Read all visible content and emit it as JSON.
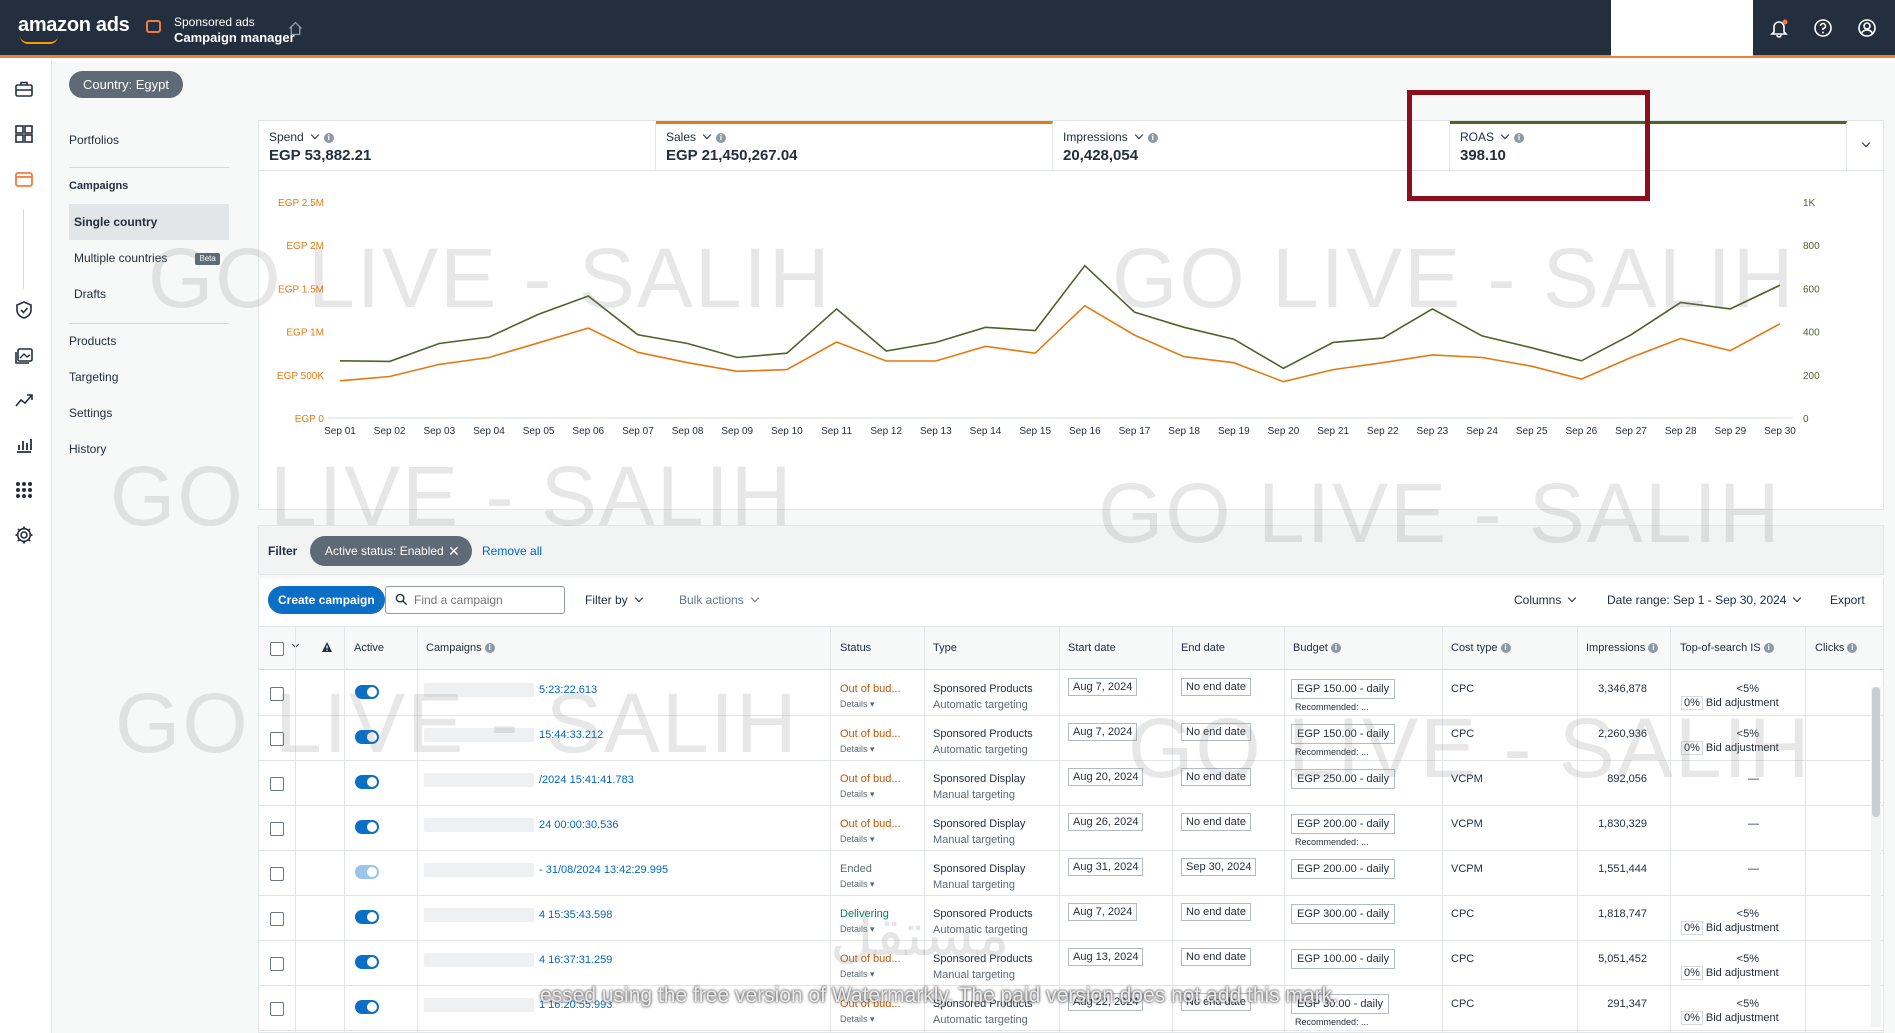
{
  "app": {
    "logo": "amazon ads",
    "name_line1": "Sponsored ads",
    "name_line2": "Campaign manager"
  },
  "sidebar": {
    "country_pill": "Country: Egypt",
    "portfolios": "Portfolios",
    "campaigns_heading": "Campaigns",
    "single_country": "Single country",
    "multiple_countries": "Multiple countries",
    "beta": "Beta",
    "drafts": "Drafts",
    "products": "Products",
    "targeting": "Targeting",
    "settings": "Settings",
    "history": "History"
  },
  "metrics": [
    {
      "label": "Spend",
      "value": "EGP 53,882.21",
      "accent": "#ffffff"
    },
    {
      "label": "Sales",
      "value": "EGP 21,450,267.04",
      "accent": "#e47911"
    },
    {
      "label": "Impressions",
      "value": "20,428,054",
      "accent": "#ffffff"
    },
    {
      "label": "ROAS",
      "value": "398.10",
      "accent": "#4f6228"
    }
  ],
  "chart_data": {
    "type": "line",
    "x": [
      "Sep 01",
      "Sep 02",
      "Sep 03",
      "Sep 04",
      "Sep 05",
      "Sep 06",
      "Sep 07",
      "Sep 08",
      "Sep 09",
      "Sep 10",
      "Sep 11",
      "Sep 12",
      "Sep 13",
      "Sep 14",
      "Sep 15",
      "Sep 16",
      "Sep 17",
      "Sep 18",
      "Sep 19",
      "Sep 20",
      "Sep 21",
      "Sep 22",
      "Sep 23",
      "Sep 24",
      "Sep 25",
      "Sep 26",
      "Sep 27",
      "Sep 28",
      "Sep 29",
      "Sep 30"
    ],
    "left_axis": {
      "ticks": [
        "EGP 0",
        "EGP 500K",
        "EGP 1M",
        "EGP 1.5M",
        "EGP 2M",
        "EGP 2.5M"
      ],
      "ylim": [
        0,
        2500000
      ]
    },
    "right_axis": {
      "ticks": [
        "0",
        "200",
        "400",
        "600",
        "800",
        "1K"
      ],
      "ylim": [
        0,
        1000
      ]
    },
    "series": [
      {
        "name": "Sales",
        "axis": "left",
        "color": "#e47911",
        "values": [
          430000,
          480000,
          620000,
          700000,
          870000,
          1040000,
          760000,
          640000,
          540000,
          560000,
          880000,
          660000,
          660000,
          830000,
          750000,
          1300000,
          960000,
          710000,
          640000,
          420000,
          560000,
          640000,
          730000,
          700000,
          600000,
          450000,
          700000,
          920000,
          780000,
          1090000
        ]
      },
      {
        "name": "ROAS",
        "axis": "right",
        "color": "#4f6228",
        "values": [
          265,
          262,
          345,
          375,
          480,
          565,
          385,
          345,
          280,
          300,
          505,
          310,
          350,
          420,
          405,
          705,
          490,
          420,
          365,
          230,
          350,
          370,
          505,
          380,
          325,
          265,
          385,
          535,
          505,
          615
        ]
      }
    ]
  },
  "filter": {
    "label": "Filter",
    "chip": "Active status: Enabled",
    "remove_all": "Remove all"
  },
  "toolbar": {
    "create": "Create campaign",
    "search_placeholder": "Find a campaign",
    "filter_by": "Filter by",
    "bulk_actions": "Bulk actions",
    "columns": "Columns",
    "date_range": "Date range: Sep 1 - Sep 30, 2024",
    "export": "Export"
  },
  "table": {
    "headers": {
      "active": "Active",
      "campaigns": "Campaigns",
      "status": "Status",
      "type": "Type",
      "start": "Start date",
      "end": "End date",
      "budget": "Budget",
      "cost_type": "Cost type",
      "impressions": "Impressions",
      "tos": "Top-of-search IS",
      "clicks": "Clicks"
    },
    "rows": [
      {
        "name": "5:23:22.613",
        "status": "Out of bud...",
        "status_kind": "out",
        "details": "Details",
        "type1": "Sponsored Products",
        "type2": "Automatic targeting",
        "start": "Aug 7, 2024",
        "end": "No end date",
        "budget": "EGP 150.00 - daily",
        "reco": "Recommended: ...",
        "cost": "CPC",
        "impr": "3,346,878",
        "tos": "<5%",
        "bid": "0%",
        "bid_label": "Bid adjustment",
        "toggle": "on"
      },
      {
        "name": "15:44:33.212",
        "status": "Out of bud...",
        "status_kind": "out",
        "details": "Details",
        "type1": "Sponsored Products",
        "type2": "Automatic targeting",
        "start": "Aug 7, 2024",
        "end": "No end date",
        "budget": "EGP 150.00 - daily",
        "reco": "Recommended: ...",
        "cost": "CPC",
        "impr": "2,260,936",
        "tos": "<5%",
        "bid": "0%",
        "bid_label": "Bid adjustment",
        "toggle": "on"
      },
      {
        "name": "/2024 15:41:41.783",
        "status": "Out of bud...",
        "status_kind": "out",
        "details": "Details",
        "type1": "Sponsored Display",
        "type2": "Manual targeting",
        "start": "Aug 20, 2024",
        "end": "No end date",
        "budget": "EGP 250.00 - daily",
        "reco": "",
        "cost": "VCPM",
        "impr": "892,056",
        "tos": "—",
        "bid": "",
        "bid_label": "",
        "toggle": "on"
      },
      {
        "name": "24 00:00:30.536",
        "status": "Out of bud...",
        "status_kind": "out",
        "details": "Details",
        "type1": "Sponsored Display",
        "type2": "Manual targeting",
        "start": "Aug 26, 2024",
        "end": "No end date",
        "budget": "EGP 200.00 - daily",
        "reco": "Recommended: ...",
        "cost": "VCPM",
        "impr": "1,830,329",
        "tos": "—",
        "bid": "",
        "bid_label": "",
        "toggle": "on"
      },
      {
        "name": "- 31/08/2024 13:42:29.995",
        "status": "Ended",
        "status_kind": "ended",
        "details": "Details",
        "type1": "Sponsored Display",
        "type2": "Manual targeting",
        "start": "Aug 31, 2024",
        "end": "Sep 30, 2024",
        "budget": "EGP 200.00 - daily",
        "reco": "",
        "cost": "VCPM",
        "impr": "1,551,444",
        "tos": "—",
        "bid": "",
        "bid_label": "",
        "toggle": "dim"
      },
      {
        "name": "4 15:35:43.598",
        "status": "Delivering",
        "status_kind": "delivering",
        "details": "Details",
        "type1": "Sponsored Products",
        "type2": "Automatic targeting",
        "start": "Aug 7, 2024",
        "end": "No end date",
        "budget": "EGP 300.00 - daily",
        "reco": "",
        "cost": "CPC",
        "impr": "1,818,747",
        "tos": "<5%",
        "bid": "0%",
        "bid_label": "Bid adjustment",
        "toggle": "on"
      },
      {
        "name": "4 16:37:31.259",
        "status": "Out of bud...",
        "status_kind": "out",
        "details": "Details",
        "type1": "Sponsored Products",
        "type2": "Manual targeting",
        "start": "Aug 13, 2024",
        "end": "No end date",
        "budget": "EGP 100.00 - daily",
        "reco": "",
        "cost": "CPC",
        "impr": "5,051,452",
        "tos": "<5%",
        "bid": "0%",
        "bid_label": "Bid adjustment",
        "toggle": "on"
      },
      {
        "name": "1 16:20:55.993",
        "status": "Out of bud...",
        "status_kind": "out",
        "details": "Details",
        "type1": "Sponsored Products",
        "type2": "Automatic targeting",
        "start": "Aug 22, 2024",
        "end": "No end date",
        "budget": "EGP 30.00 - daily",
        "reco": "Recommended: ...",
        "cost": "CPC",
        "impr": "291,347",
        "tos": "<5%",
        "bid": "0%",
        "bid_label": "Bid adjustment",
        "toggle": "on"
      }
    ]
  },
  "watermark": "GO LIVE - SALIH",
  "caption": "essed using the free version of Watermarkly. The paid version does not add this mark.",
  "caption_logo": "مستقل"
}
